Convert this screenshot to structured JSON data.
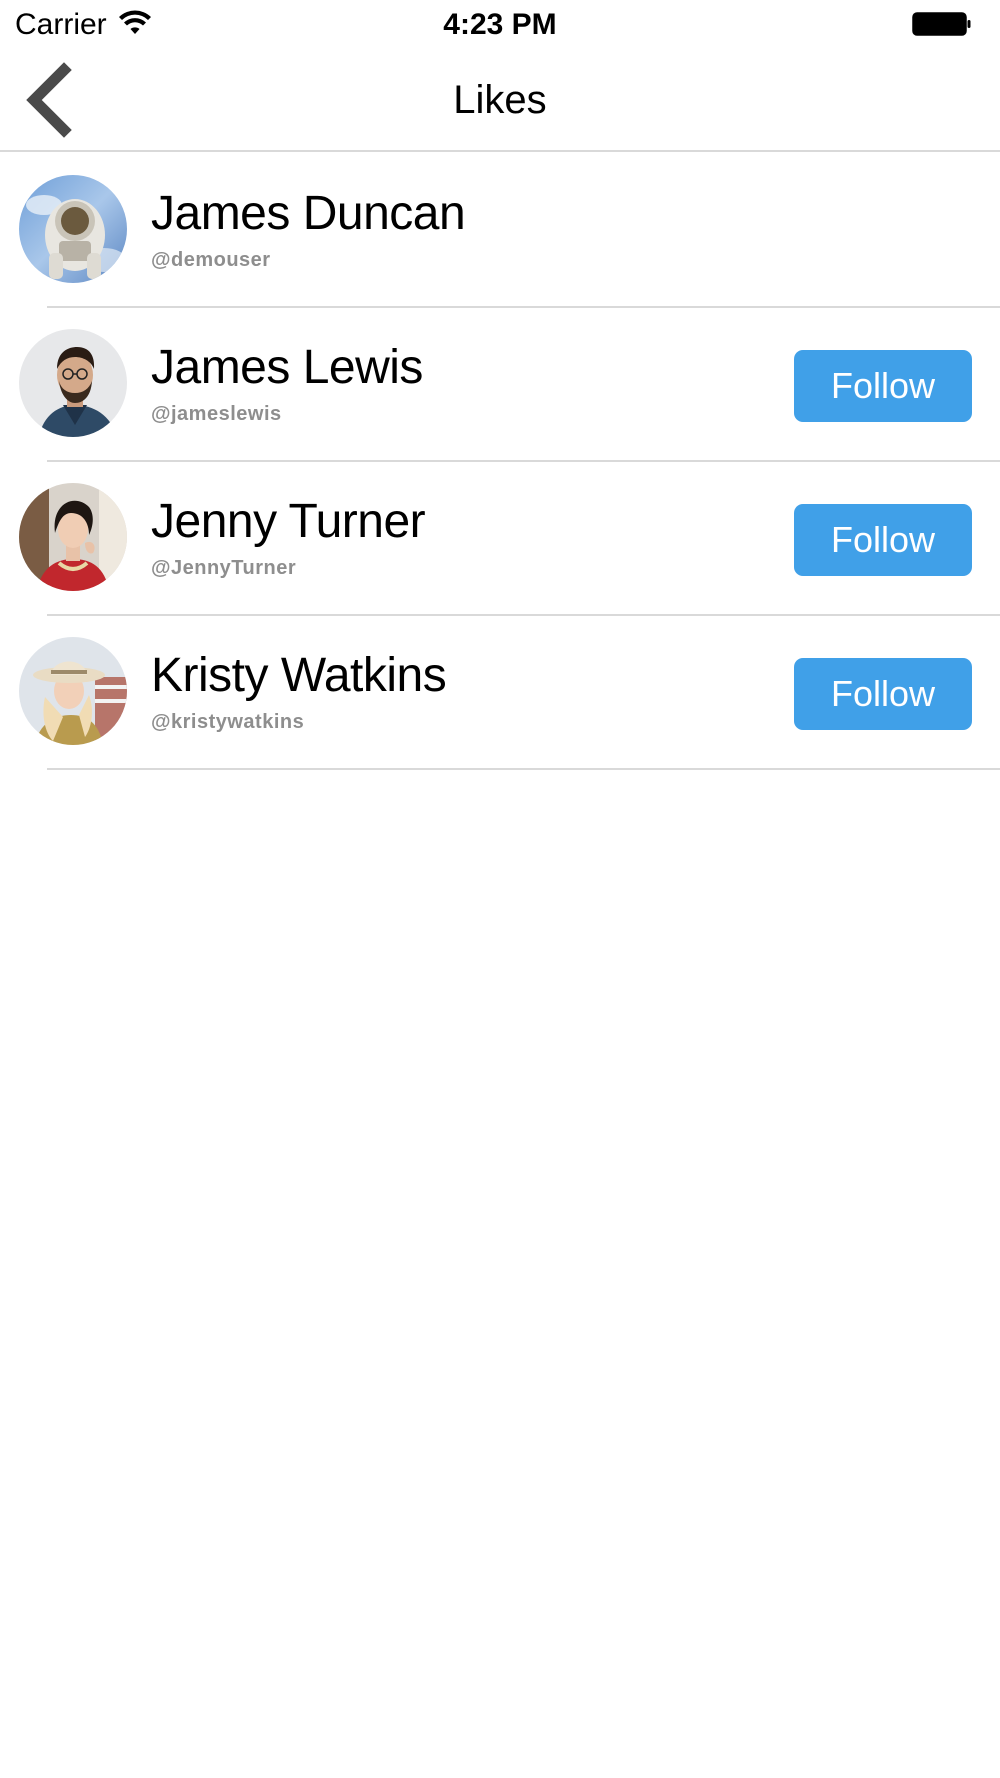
{
  "status_bar": {
    "carrier": "Carrier",
    "time": "4:23 PM",
    "wifi_icon": "wifi-icon",
    "battery_icon": "battery-icon"
  },
  "nav": {
    "title": "Likes",
    "back_icon": "chevron-left-icon"
  },
  "colors": {
    "accent": "#40a0e8",
    "handle": "#8e8e8e",
    "divider": "#d9d9d9"
  },
  "users": [
    {
      "name": "James Duncan",
      "handle": "@demouser",
      "follow_label": null
    },
    {
      "name": "James Lewis",
      "handle": "@jameslewis",
      "follow_label": "Follow"
    },
    {
      "name": "Jenny Turner",
      "handle": "@JennyTurner",
      "follow_label": "Follow"
    },
    {
      "name": "Kristy Watkins",
      "handle": "@kristywatkins",
      "follow_label": "Follow"
    }
  ]
}
